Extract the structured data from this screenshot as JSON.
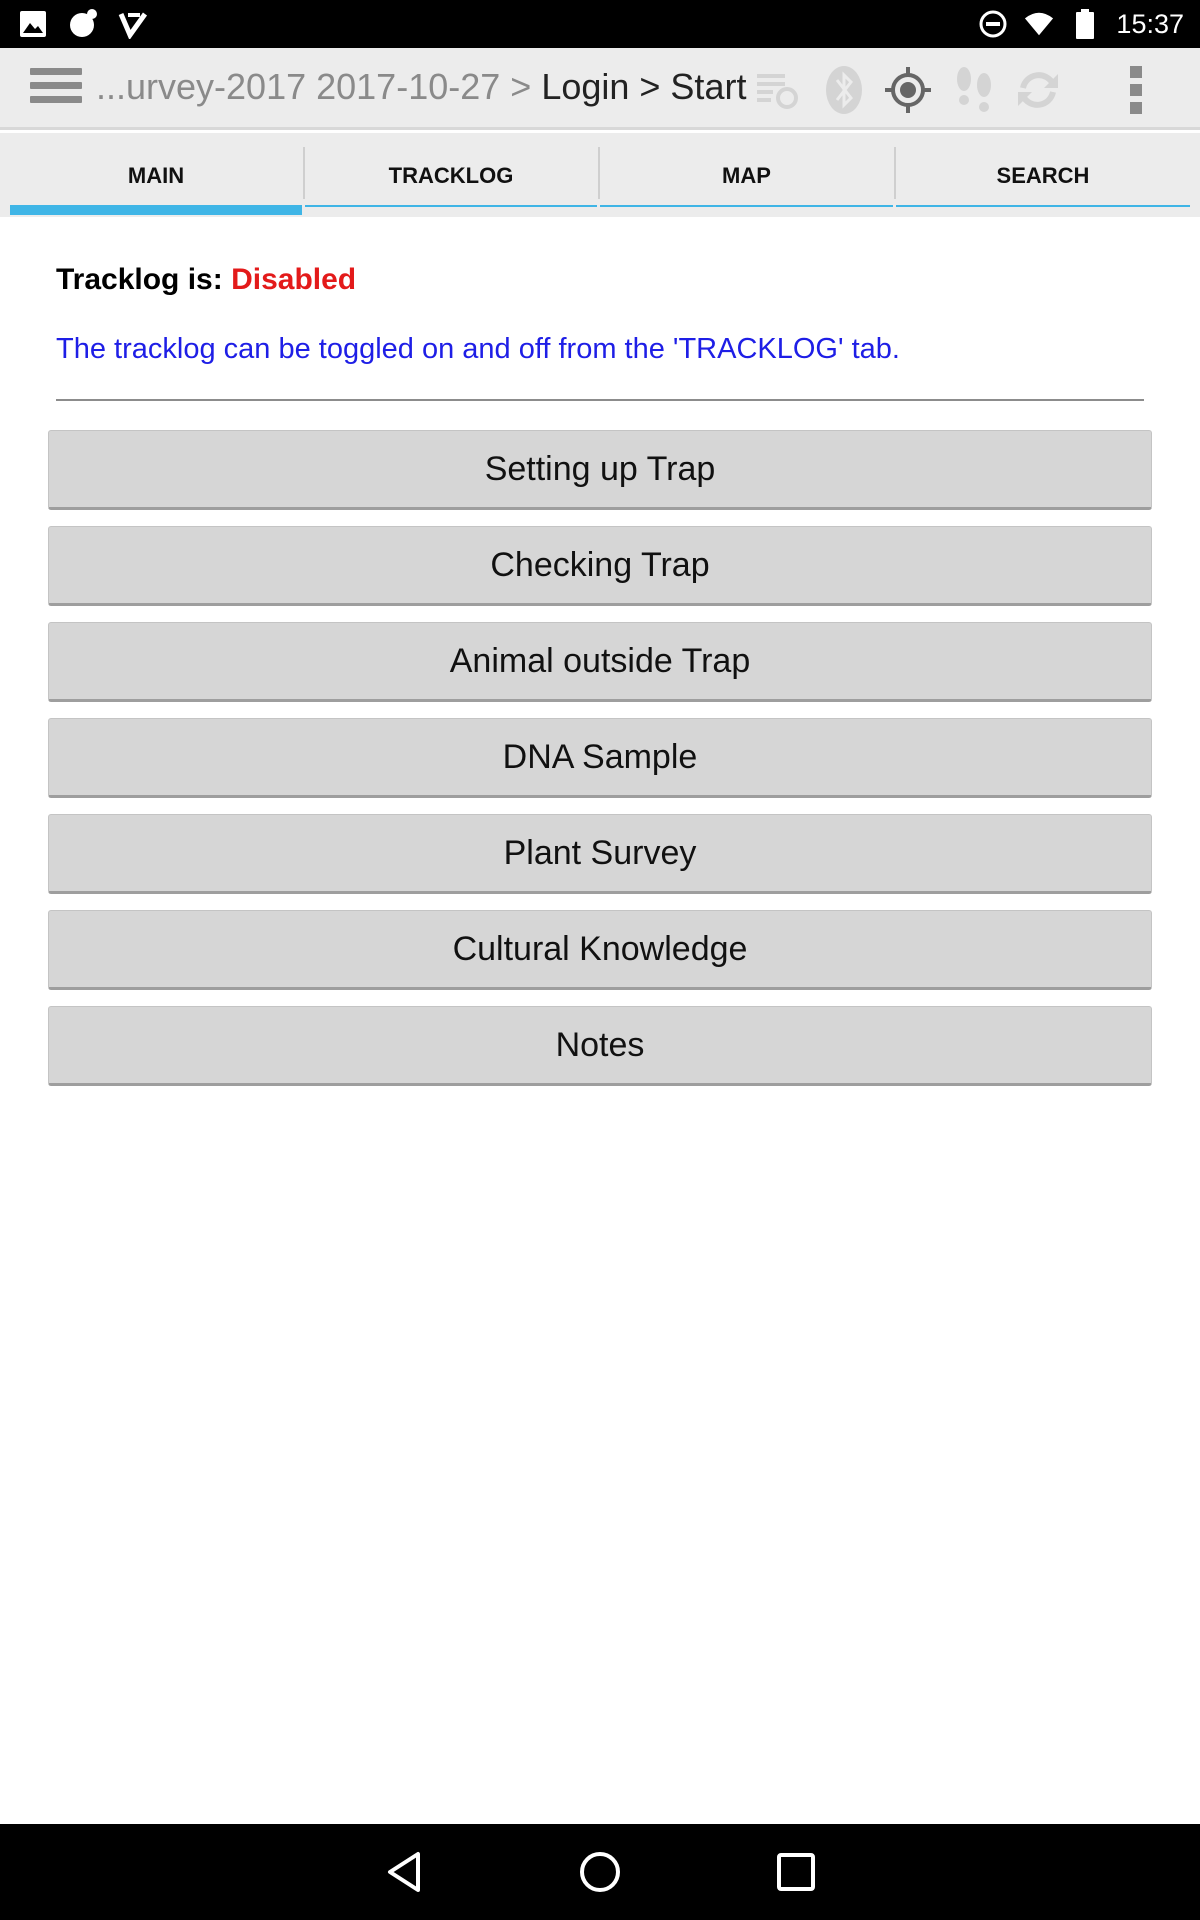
{
  "status_bar": {
    "time": "15:37",
    "left_icons": [
      "image-icon",
      "app-notification-icon",
      "download-done-icon"
    ],
    "right_icons": [
      "do-not-disturb-icon",
      "wifi-icon",
      "battery-icon"
    ]
  },
  "action_bar": {
    "breadcrumb_prefix": "...urvey-2017 2017-10-27 >",
    "breadcrumb_current": "Login > Start",
    "icons": [
      "sync-list-icon",
      "bluetooth-icon",
      "gps-target-icon",
      "footprints-icon",
      "refresh-icon",
      "overflow-menu-icon"
    ]
  },
  "tabs": [
    {
      "label": "MAIN",
      "active": true
    },
    {
      "label": "TRACKLOG",
      "active": false
    },
    {
      "label": "MAP",
      "active": false
    },
    {
      "label": "SEARCH",
      "active": false
    }
  ],
  "main": {
    "status_label": "Tracklog is:",
    "status_value": "Disabled",
    "hint": "The tracklog can be toggled on and off from the 'TRACKLOG' tab.",
    "buttons": [
      "Setting up Trap",
      "Checking Trap",
      "Animal outside Trap",
      "DNA Sample",
      "Plant Survey",
      "Cultural Knowledge",
      "Notes"
    ]
  },
  "colors": {
    "accent": "#3fb5e6",
    "status_disabled": "#e31a1a",
    "hint": "#1e1ee6"
  }
}
